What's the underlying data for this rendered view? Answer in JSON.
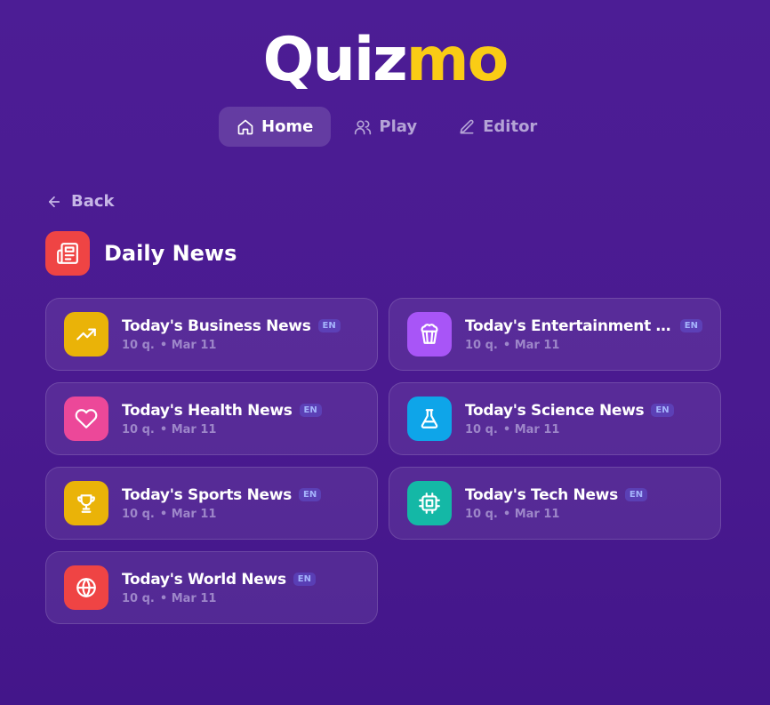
{
  "logo": {
    "part1": "Quiz",
    "part2": "mo"
  },
  "nav": {
    "items": [
      {
        "label": "Home",
        "icon": "home-icon",
        "active": true
      },
      {
        "label": "Play",
        "icon": "users-icon",
        "active": false
      },
      {
        "label": "Editor",
        "icon": "pencil-icon",
        "active": false
      }
    ]
  },
  "back_label": "Back",
  "category": {
    "title": "Daily News",
    "icon": "newspaper-icon",
    "color": "#ef4444"
  },
  "quizzes": [
    {
      "title": "Today's Business News",
      "lang": "EN",
      "questions": "10 q.",
      "date": "• Mar 11",
      "icon": "trending-up-icon",
      "color": "#eab308"
    },
    {
      "title": "Today's Entertainment ...",
      "lang": "EN",
      "questions": "10 q.",
      "date": "• Mar 11",
      "icon": "popcorn-icon",
      "color": "#a855f7"
    },
    {
      "title": "Today's Health News",
      "lang": "EN",
      "questions": "10 q.",
      "date": "• Mar 11",
      "icon": "heart-icon",
      "color": "#ec4899"
    },
    {
      "title": "Today's Science News",
      "lang": "EN",
      "questions": "10 q.",
      "date": "• Mar 11",
      "icon": "flask-icon",
      "color": "#0ea5e9"
    },
    {
      "title": "Today's Sports News",
      "lang": "EN",
      "questions": "10 q.",
      "date": "• Mar 11",
      "icon": "trophy-icon",
      "color": "#eab308"
    },
    {
      "title": "Today's Tech News",
      "lang": "EN",
      "questions": "10 q.",
      "date": "• Mar 11",
      "icon": "chip-icon",
      "color": "#14b8a6"
    },
    {
      "title": "Today's World News",
      "lang": "EN",
      "questions": "10 q.",
      "date": "• Mar 11",
      "icon": "globe-icon",
      "color": "#ef4444"
    }
  ]
}
